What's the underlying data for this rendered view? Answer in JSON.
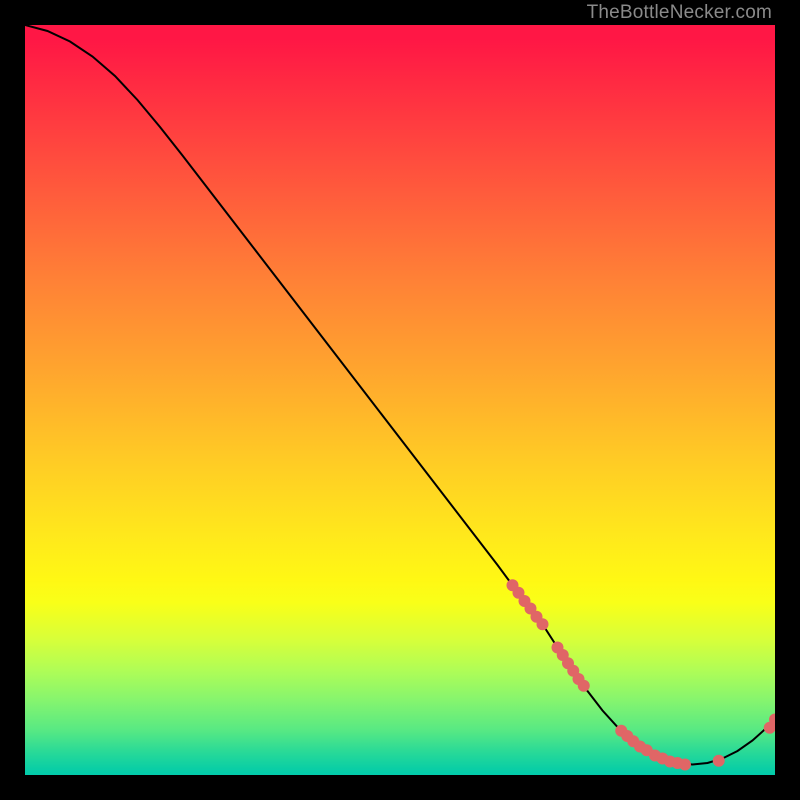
{
  "watermark": "TheBottleNecker.com",
  "chart_data": {
    "type": "line",
    "title": "",
    "xlabel": "",
    "ylabel": "",
    "xlim": [
      0,
      100
    ],
    "ylim": [
      0,
      100
    ],
    "grid": false,
    "legend_position": "none",
    "curve": [
      {
        "x": 0,
        "y": 100.0
      },
      {
        "x": 3,
        "y": 99.2
      },
      {
        "x": 6,
        "y": 97.8
      },
      {
        "x": 9,
        "y": 95.8
      },
      {
        "x": 12,
        "y": 93.2
      },
      {
        "x": 15,
        "y": 90.0
      },
      {
        "x": 18,
        "y": 86.4
      },
      {
        "x": 21,
        "y": 82.6
      },
      {
        "x": 24,
        "y": 78.7
      },
      {
        "x": 27,
        "y": 74.8
      },
      {
        "x": 30,
        "y": 70.9
      },
      {
        "x": 33,
        "y": 67.0
      },
      {
        "x": 36,
        "y": 63.1
      },
      {
        "x": 39,
        "y": 59.2
      },
      {
        "x": 42,
        "y": 55.3
      },
      {
        "x": 45,
        "y": 51.4
      },
      {
        "x": 48,
        "y": 47.5
      },
      {
        "x": 51,
        "y": 43.6
      },
      {
        "x": 54,
        "y": 39.7
      },
      {
        "x": 57,
        "y": 35.8
      },
      {
        "x": 60,
        "y": 31.9
      },
      {
        "x": 63,
        "y": 28.0
      },
      {
        "x": 65,
        "y": 25.3
      },
      {
        "x": 67,
        "y": 22.7
      },
      {
        "x": 69,
        "y": 20.1
      },
      {
        "x": 71,
        "y": 17.0
      },
      {
        "x": 73,
        "y": 14.0
      },
      {
        "x": 75,
        "y": 11.2
      },
      {
        "x": 77,
        "y": 8.6
      },
      {
        "x": 79,
        "y": 6.4
      },
      {
        "x": 81,
        "y": 4.6
      },
      {
        "x": 83,
        "y": 3.2
      },
      {
        "x": 85,
        "y": 2.2
      },
      {
        "x": 87,
        "y": 1.6
      },
      {
        "x": 89,
        "y": 1.4
      },
      {
        "x": 91,
        "y": 1.6
      },
      {
        "x": 93,
        "y": 2.2
      },
      {
        "x": 95,
        "y": 3.2
      },
      {
        "x": 97,
        "y": 4.6
      },
      {
        "x": 99,
        "y": 6.4
      },
      {
        "x": 100,
        "y": 7.4
      }
    ],
    "markers": [
      {
        "x": 65.0,
        "y": 25.3
      },
      {
        "x": 65.8,
        "y": 24.3
      },
      {
        "x": 66.6,
        "y": 23.2
      },
      {
        "x": 67.4,
        "y": 22.2
      },
      {
        "x": 68.2,
        "y": 21.1
      },
      {
        "x": 69.0,
        "y": 20.1
      },
      {
        "x": 71.0,
        "y": 17.0
      },
      {
        "x": 71.7,
        "y": 16.0
      },
      {
        "x": 72.4,
        "y": 14.9
      },
      {
        "x": 73.1,
        "y": 13.9
      },
      {
        "x": 73.8,
        "y": 12.8
      },
      {
        "x": 74.5,
        "y": 11.9
      },
      {
        "x": 79.5,
        "y": 5.9
      },
      {
        "x": 80.3,
        "y": 5.2
      },
      {
        "x": 81.1,
        "y": 4.5
      },
      {
        "x": 82.0,
        "y": 3.8
      },
      {
        "x": 82.9,
        "y": 3.3
      },
      {
        "x": 84.0,
        "y": 2.6
      },
      {
        "x": 85.0,
        "y": 2.2
      },
      {
        "x": 86.0,
        "y": 1.8
      },
      {
        "x": 87.0,
        "y": 1.6
      },
      {
        "x": 88.0,
        "y": 1.4
      },
      {
        "x": 92.5,
        "y": 1.9
      },
      {
        "x": 99.3,
        "y": 6.3
      },
      {
        "x": 100.0,
        "y": 7.4
      }
    ],
    "marker_color": "#e06666",
    "line_color": "#000000"
  }
}
